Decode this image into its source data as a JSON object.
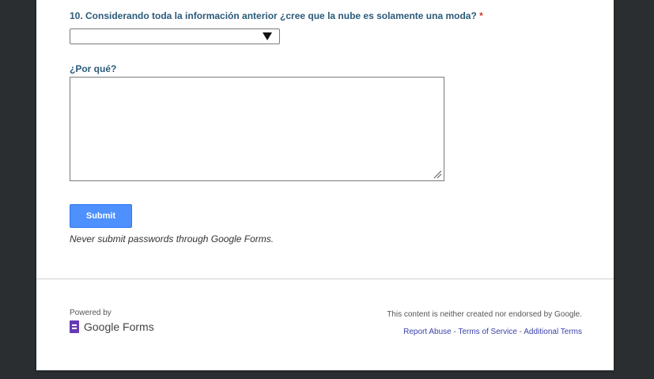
{
  "question": {
    "title": "10. Considerando toda la información anterior ¿cree que la nube es solamente una moda?",
    "required_marker": "*",
    "select_value": ""
  },
  "why": {
    "label": "¿Por qué?",
    "value": ""
  },
  "submit": {
    "label": "Submit",
    "warning": "Never submit passwords through Google Forms."
  },
  "footer": {
    "powered_by": "Powered by",
    "brand": "Google Forms",
    "disclaimer": "This content is neither created nor endorsed by Google.",
    "links": [
      "Report Abuse",
      "Terms of Service",
      "Additional Terms"
    ],
    "separator": " - "
  },
  "colors": {
    "background": "#2a2e31",
    "question_text": "#2b5a7a",
    "submit_button": "#4d90fe",
    "link": "#3b41a8",
    "forms_brand": "#673ab7"
  }
}
